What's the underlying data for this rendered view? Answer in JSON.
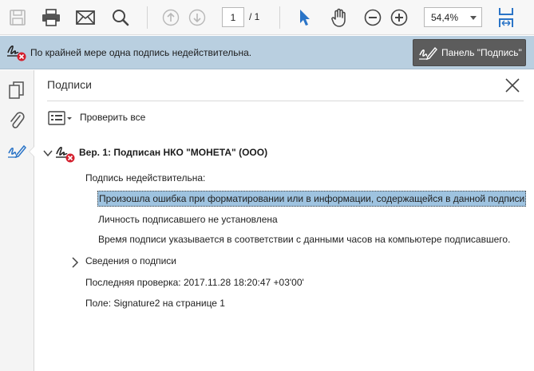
{
  "toolbar": {
    "page_current": "1",
    "page_total": "/ 1",
    "zoom": "54,4%"
  },
  "message_bar": {
    "text": "По крайней мере одна подпись недействительна.",
    "panel_button": "Панель \"Подпись\""
  },
  "panel": {
    "title": "Подписи",
    "verify_all": "Проверить все",
    "signature": {
      "header": "Вер. 1: Подписан НКО \"МОНЕТА\" (ООО)",
      "status": "Подпись недействительна:",
      "details": [
        "Произошла ошибка при форматировании или в информации, содержащейся в данной подписи",
        "Личность подписавшего не установлена",
        "Время подписи указывается в соответствии с данными часов на компьютере подписавшего."
      ],
      "info_toggle": "Сведения о подписи",
      "last_check": "Последняя проверка: 2017.11.28 18:20:47 +03'00'",
      "field": "Поле: Signature2 на странице 1"
    }
  },
  "colors": {
    "message_bar_bg": "#b9cfe0",
    "highlight_bg": "#9ec3e0",
    "accent_blue": "#2a74c7",
    "error_red": "#d4202e"
  }
}
